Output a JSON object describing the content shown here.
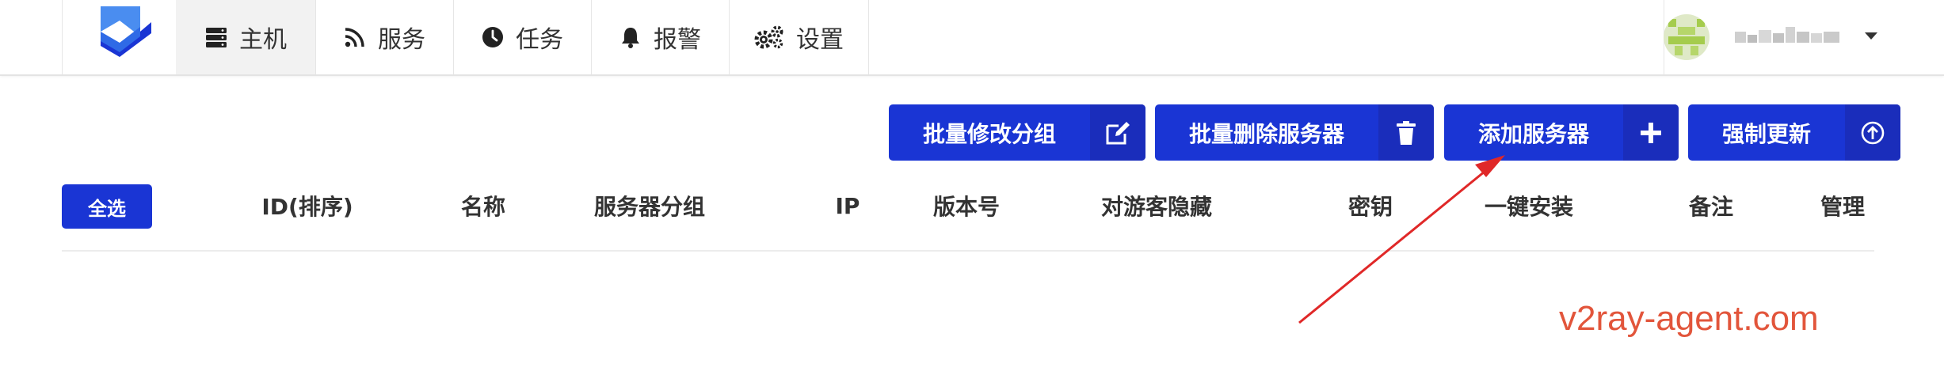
{
  "nav": {
    "items": [
      {
        "label": "主机",
        "icon": "server-icon",
        "active": true
      },
      {
        "label": "服务",
        "icon": "rss-icon",
        "active": false
      },
      {
        "label": "任务",
        "icon": "clock-icon",
        "active": false
      },
      {
        "label": "报警",
        "icon": "bell-icon",
        "active": false
      },
      {
        "label": "设置",
        "icon": "cogs-icon",
        "active": false
      }
    ],
    "user_icon": "chevron-down-icon"
  },
  "actions": {
    "batch_edit_group": "批量修改分组",
    "batch_delete": "批量删除服务器",
    "add_server": "添加服务器",
    "force_update": "强制更新"
  },
  "table": {
    "select_all": "全选",
    "headers": [
      "ID(排序)",
      "名称",
      "服务器分组",
      "IP",
      "版本号",
      "对游客隐藏",
      "密钥",
      "一键安装",
      "备注",
      "管理"
    ]
  },
  "watermark": "v2ray-agent.com",
  "colors": {
    "primary": "#1a35d4",
    "annotation": "#e2553b"
  }
}
